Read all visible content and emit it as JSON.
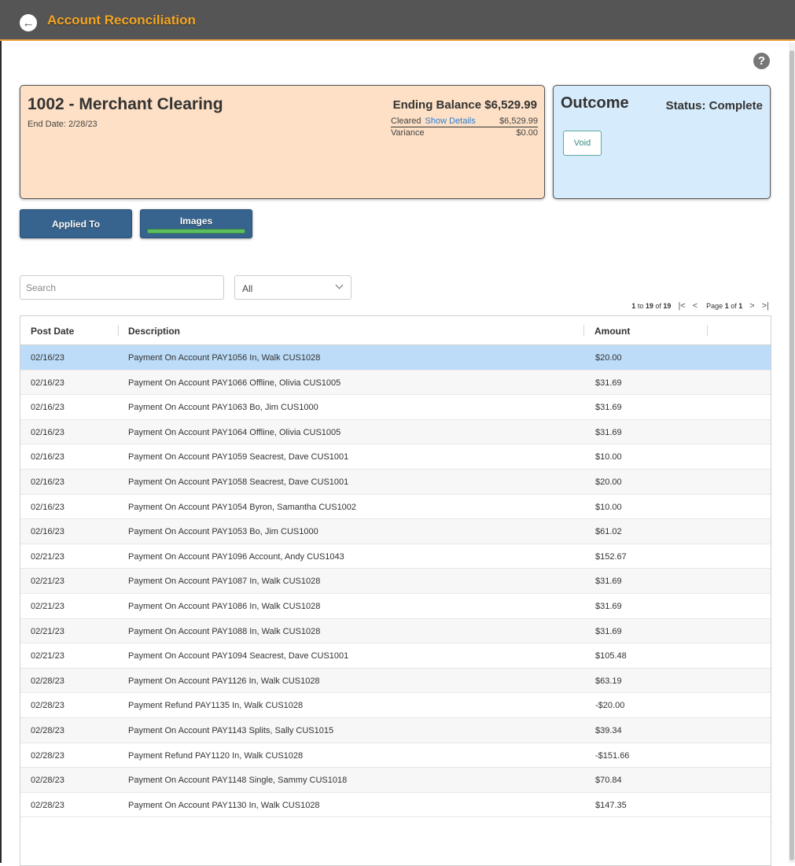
{
  "header": {
    "title": "Account Reconciliation",
    "back_icon": "arrow-circle-left-icon"
  },
  "account": {
    "name": "1002 - Merchant Clearing",
    "end_date_label": "End Date: 2/28/23",
    "ending_balance_label": "Ending Balance",
    "ending_balance": "$6,529.99",
    "cleared_label": "Cleared",
    "show_details_label": "Show Details",
    "cleared_amount": "$6,529.99",
    "variance_label": "Variance",
    "variance_amount": "$0.00",
    "bg_color": "#fde0c5"
  },
  "outcome": {
    "title": "Outcome",
    "status": "Status: Complete",
    "void_label": "Void",
    "bg_color": "#d6ebfb"
  },
  "actions": {
    "applied_to_label": "Applied To",
    "images_label": "Images"
  },
  "filters": {
    "search_placeholder": "Search",
    "select_value": "All"
  },
  "pagination": {
    "range_start": "1",
    "range_to": "to",
    "range_end": "19",
    "of_label": "of",
    "total": "19",
    "page_label": "Page",
    "page": "1",
    "page_of": "of",
    "page_count": "1"
  },
  "table": {
    "columns": [
      "Post Date",
      "Description",
      "Amount"
    ],
    "rows": [
      {
        "date": "02/16/23",
        "description": "Payment On Account PAY1056 In, Walk CUS1028",
        "amount": "$20.00"
      },
      {
        "date": "02/16/23",
        "description": "Payment On Account PAY1066 Offline, Olivia CUS1005",
        "amount": "$31.69"
      },
      {
        "date": "02/16/23",
        "description": "Payment On Account PAY1063 Bo, Jim CUS1000",
        "amount": "$31.69"
      },
      {
        "date": "02/16/23",
        "description": "Payment On Account PAY1064 Offline, Olivia CUS1005",
        "amount": "$31.69"
      },
      {
        "date": "02/16/23",
        "description": "Payment On Account PAY1059 Seacrest, Dave CUS1001",
        "amount": "$10.00"
      },
      {
        "date": "02/16/23",
        "description": "Payment On Account PAY1058 Seacrest, Dave CUS1001",
        "amount": "$20.00"
      },
      {
        "date": "02/16/23",
        "description": "Payment On Account PAY1054 Byron, Samantha CUS1002",
        "amount": "$10.00"
      },
      {
        "date": "02/16/23",
        "description": "Payment On Account PAY1053 Bo, Jim CUS1000",
        "amount": "$61.02"
      },
      {
        "date": "02/21/23",
        "description": "Payment On Account PAY1096 Account, Andy CUS1043",
        "amount": "$152.67"
      },
      {
        "date": "02/21/23",
        "description": "Payment On Account PAY1087 In, Walk CUS1028",
        "amount": "$31.69"
      },
      {
        "date": "02/21/23",
        "description": "Payment On Account PAY1086 In, Walk CUS1028",
        "amount": "$31.69"
      },
      {
        "date": "02/21/23",
        "description": "Payment On Account PAY1088 In, Walk CUS1028",
        "amount": "$31.69"
      },
      {
        "date": "02/21/23",
        "description": "Payment On Account PAY1094 Seacrest, Dave CUS1001",
        "amount": "$105.48"
      },
      {
        "date": "02/28/23",
        "description": "Payment On Account PAY1126 In, Walk CUS1028",
        "amount": "$63.19"
      },
      {
        "date": "02/28/23",
        "description": "Payment Refund PAY1135 In, Walk CUS1028",
        "amount": "-$20.00"
      },
      {
        "date": "02/28/23",
        "description": "Payment On Account PAY1143 Splits, Sally CUS1015",
        "amount": "$39.34"
      },
      {
        "date": "02/28/23",
        "description": "Payment Refund PAY1120 In, Walk CUS1028",
        "amount": "-$151.66"
      },
      {
        "date": "02/28/23",
        "description": "Payment On Account PAY1148 Single, Sammy CUS1018",
        "amount": "$70.84"
      },
      {
        "date": "02/28/23",
        "description": "Payment On Account PAY1130 In, Walk CUS1028",
        "amount": "$147.35"
      }
    ],
    "selected_index": 0,
    "selected_color": "#bcdcf8"
  }
}
